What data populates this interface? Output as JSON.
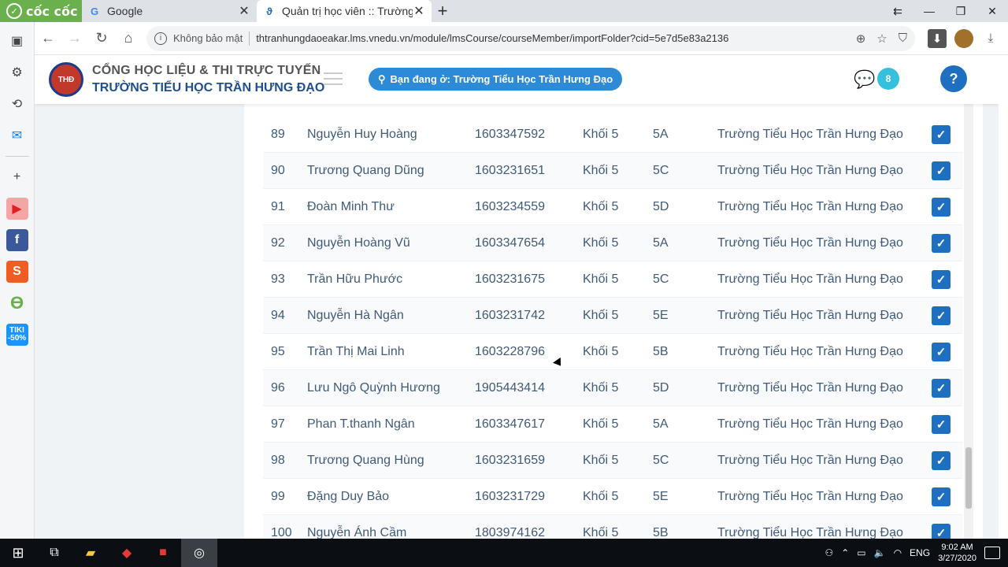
{
  "browser": {
    "brand": "cốc cốc",
    "tabs": [
      {
        "label": "Google",
        "active": false,
        "icon": "google-g-icon"
      },
      {
        "label": "Quản trị học viên :: Trường Tiể",
        "active": true,
        "icon": "vnedu-icon"
      }
    ],
    "address": {
      "security_label": "Không bảo mật",
      "url": "thtranhungdaoeakar.lms.vnedu.vn/module/lmsCourse/courseMember/importFolder?cid=5e7d5e83a2136"
    }
  },
  "site": {
    "title_line1": "CỔNG HỌC LIỆU & THI TRỰC TUYẾN",
    "title_line2": "TRƯỜNG TIỂU HỌC TRẦN HƯNG ĐẠO",
    "location_label": "Bạn đang ở: Trường Tiểu Học Trần Hưng Đạo",
    "notification_count": "8",
    "help_label": "?"
  },
  "students": [
    {
      "no": "89",
      "name": "Nguyễn Huy Hoàng",
      "id": "1603347592",
      "grade": "Khối 5",
      "class": "5A",
      "school": "Trường Tiểu Học Trần Hưng Đạo",
      "checked": true
    },
    {
      "no": "90",
      "name": "Trương Quang Dũng",
      "id": "1603231651",
      "grade": "Khối 5",
      "class": "5C",
      "school": "Trường Tiểu Học Trần Hưng Đạo",
      "checked": true
    },
    {
      "no": "91",
      "name": "Đoàn Minh Thư",
      "id": "1603234559",
      "grade": "Khối 5",
      "class": "5D",
      "school": "Trường Tiểu Học Trần Hưng Đạo",
      "checked": true
    },
    {
      "no": "92",
      "name": "Nguyễn Hoàng Vũ",
      "id": "1603347654",
      "grade": "Khối 5",
      "class": "5A",
      "school": "Trường Tiểu Học Trần Hưng Đạo",
      "checked": true
    },
    {
      "no": "93",
      "name": "Trần Hữu Phước",
      "id": "1603231675",
      "grade": "Khối 5",
      "class": "5C",
      "school": "Trường Tiểu Học Trần Hưng Đạo",
      "checked": true
    },
    {
      "no": "94",
      "name": "Nguyễn Hà Ngân",
      "id": "1603231742",
      "grade": "Khối 5",
      "class": "5E",
      "school": "Trường Tiểu Học Trần Hưng Đạo",
      "checked": true
    },
    {
      "no": "95",
      "name": "Trần Thị Mai Linh",
      "id": "1603228796",
      "grade": "Khối 5",
      "class": "5B",
      "school": "Trường Tiểu Học Trần Hưng Đạo",
      "checked": true
    },
    {
      "no": "96",
      "name": "Lưu Ngô Quỳnh Hương",
      "id": "1905443414",
      "grade": "Khối 5",
      "class": "5D",
      "school": "Trường Tiểu Học Trần Hưng Đạo",
      "checked": true
    },
    {
      "no": "97",
      "name": "Phan T.thanh Ngân",
      "id": "1603347617",
      "grade": "Khối 5",
      "class": "5A",
      "school": "Trường Tiểu Học Trần Hưng Đạo",
      "checked": true
    },
    {
      "no": "98",
      "name": "Trương Quang Hùng",
      "id": "1603231659",
      "grade": "Khối 5",
      "class": "5C",
      "school": "Trường Tiểu Học Trần Hưng Đạo",
      "checked": true
    },
    {
      "no": "99",
      "name": "Đặng Duy Bảo",
      "id": "1603231729",
      "grade": "Khối 5",
      "class": "5E",
      "school": "Trường Tiểu Học Trần Hưng Đạo",
      "checked": true
    },
    {
      "no": "100",
      "name": "Nguyễn Ánh Cầm",
      "id": "1803974162",
      "grade": "Khối 5",
      "class": "5B",
      "school": "Trường Tiểu Học Trần Hưng Đạo",
      "checked": true
    }
  ],
  "taskbar": {
    "language": "ENG",
    "time": "9:02 AM",
    "date": "3/27/2020"
  },
  "colors": {
    "accent": "#1e6fc0",
    "pill": "#2d8ad6",
    "text_row": "#3f5b78"
  }
}
